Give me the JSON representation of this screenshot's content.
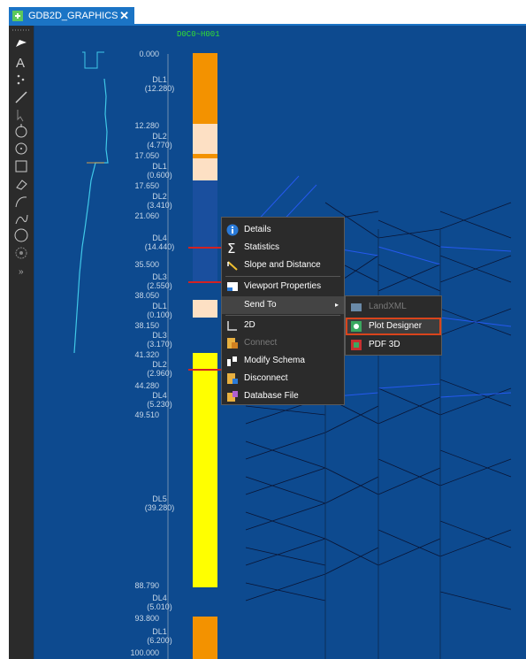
{
  "tab": {
    "title": "GDB2D_GRAPHICS",
    "close": "✕",
    "icon": "graphics-icon"
  },
  "strip": {
    "title": "D0C0~H001",
    "depths": [
      "0.000",
      "12.280",
      "17.050",
      "17.650",
      "21.060",
      "35.500",
      "38.050",
      "38.150",
      "41.320",
      "44.280",
      "49.510",
      "88.790",
      "93.800",
      "100.000"
    ],
    "layers": [
      {
        "code": "DL1",
        "thickness": "(12.280)"
      },
      {
        "code": "DL2",
        "thickness": "(4.770)"
      },
      {
        "code": "DL1",
        "thickness": "(0.600)"
      },
      {
        "code": "DL2",
        "thickness": "(3.410)"
      },
      {
        "code": "DL4",
        "thickness": "(14.440)"
      },
      {
        "code": "DL3",
        "thickness": "(2.550)"
      },
      {
        "code": "DL1",
        "thickness": "(0.100)"
      },
      {
        "code": "DL3",
        "thickness": "(3.170)"
      },
      {
        "code": "DL2",
        "thickness": "(2.960)"
      },
      {
        "code": "DL4",
        "thickness": "(5.230)"
      },
      {
        "code": "DL5",
        "thickness": "(39.280)"
      },
      {
        "code": "DL4",
        "thickness": "(5.010)"
      },
      {
        "code": "DL1",
        "thickness": "(6.200)"
      }
    ],
    "colors": {
      "DL1": "#f39200",
      "DL1_light": "#fde0c4",
      "DL2": "#fde0c4",
      "DL3": "#1a4f9e",
      "DL4": "#1a4f9e",
      "DL5": "#ffff00",
      "background": "#0d4a8f",
      "marker": "#d22222"
    }
  },
  "toolbar": {
    "tools": [
      "select-icon",
      "text-icon",
      "points-icon",
      "line-icon",
      "cursor-icon",
      "circle-target-icon",
      "circle-icon",
      "rectangle-icon",
      "eraser-icon",
      "arc-icon",
      "curve-icon",
      "polygon-icon",
      "settings-icon",
      "more-icon"
    ]
  },
  "context_menu": {
    "items": [
      {
        "label": "Details",
        "icon": "info-icon",
        "enabled": true
      },
      {
        "label": "Statistics",
        "icon": "sigma-icon",
        "enabled": true
      },
      {
        "label": "Slope and Distance",
        "icon": "slope-icon",
        "enabled": true
      },
      {
        "label": "Viewport Properties",
        "icon": "viewport-icon",
        "enabled": true
      },
      {
        "label": "Send To",
        "icon": "",
        "enabled": true,
        "submenu": true
      },
      {
        "label": "2D",
        "icon": "2d-icon",
        "enabled": true
      },
      {
        "label": "Connect",
        "icon": "connect-icon",
        "enabled": false
      },
      {
        "label": "Modify Schema",
        "icon": "schema-icon",
        "enabled": true
      },
      {
        "label": "Disconnect",
        "icon": "disconnect-icon",
        "enabled": true
      },
      {
        "label": "Database File",
        "icon": "database-icon",
        "enabled": true
      }
    ],
    "submenu": [
      {
        "label": "LandXML",
        "icon": "landxml-icon",
        "enabled": false
      },
      {
        "label": "Plot Designer",
        "icon": "plot-designer-icon",
        "enabled": true,
        "selected": true
      },
      {
        "label": "PDF 3D",
        "icon": "pdf3d-icon",
        "enabled": true
      }
    ]
  }
}
